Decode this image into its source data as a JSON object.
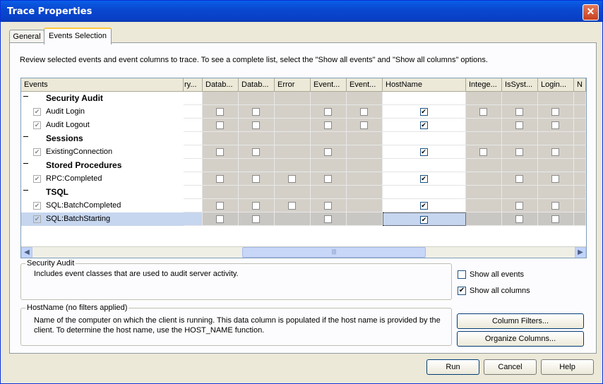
{
  "window": {
    "title": "Trace Properties",
    "close_glyph": "✕"
  },
  "tabs": [
    {
      "label": "General"
    },
    {
      "label": "Events Selection"
    }
  ],
  "hint": "Review selected events and event columns to trace. To see a complete list, select the \"Show all events\" and \"Show all columns\" options.",
  "grid": {
    "columns": [
      "Events",
      "ry...",
      "Datab...",
      "Datab...",
      "Error",
      "Event...",
      "Event...",
      "HostName",
      "Intege...",
      "IsSyst...",
      "Login...",
      "N"
    ],
    "rows": [
      {
        "type": "category",
        "name": "Security Audit"
      },
      {
        "type": "event",
        "name": "Audit Login"
      },
      {
        "type": "event",
        "name": "Audit Logout"
      },
      {
        "type": "category",
        "name": "Sessions"
      },
      {
        "type": "event",
        "name": "ExistingConnection"
      },
      {
        "type": "category",
        "name": "Stored Procedures"
      },
      {
        "type": "event",
        "name": "RPC:Completed"
      },
      {
        "type": "category",
        "name": "TSQL"
      },
      {
        "type": "event",
        "name": "SQL:BatchCompleted"
      },
      {
        "type": "event",
        "name": "SQL:BatchStarting"
      }
    ],
    "check_glyph": "✔"
  },
  "event_group": {
    "legend": "Security Audit",
    "desc": "Includes event classes that are used to audit server activity."
  },
  "column_group": {
    "legend": "HostName (no filters applied)",
    "desc": "Name of the computer on which the client is running. This data column is populated if the host name is provided by the client. To determine the host name, use the HOST_NAME function."
  },
  "options": {
    "show_all_events": "Show all events",
    "show_all_columns": "Show all columns"
  },
  "buttons": {
    "column_filters": "Column Filters...",
    "organize_columns": "Organize Columns...",
    "run": "Run",
    "cancel": "Cancel",
    "help": "Help"
  }
}
